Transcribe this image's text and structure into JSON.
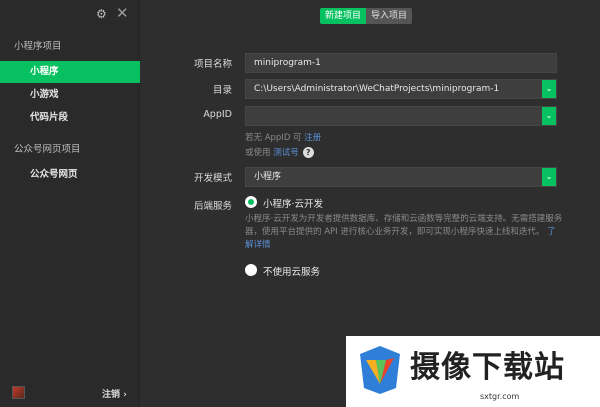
{
  "sidebar": {
    "section_miniprogram": "小程序项目",
    "items_miniprogram": [
      {
        "label": "小程序",
        "active": true
      },
      {
        "label": "小游戏",
        "active": false
      },
      {
        "label": "代码片段",
        "active": false
      }
    ],
    "section_official": "公众号网页项目",
    "items_official": [
      {
        "label": "公众号网页",
        "active": false
      }
    ],
    "logout_label": "注销 ›"
  },
  "tabs": {
    "new_project": "新建项目",
    "import_project": "导入项目"
  },
  "form": {
    "name_label": "项目名称",
    "name_value": "miniprogram-1",
    "dir_label": "目录",
    "dir_value": "C:\\Users\\Administrator\\WeChatProjects\\miniprogram-1",
    "appid_label": "AppID",
    "appid_value": "",
    "hint1_prefix": "若无 AppID 可 ",
    "hint1_link": "注册",
    "hint2_prefix": "或使用 ",
    "hint2_link": "测试号",
    "dev_mode_label": "开发模式",
    "dev_mode_value": "小程序",
    "backend_label": "后端服务",
    "cloud_option": "小程序·云开发",
    "cloud_desc": "小程序·云开发为开发者提供数据库、存储和云函数等完整的云端支持。无需搭建服务器，使用平台提供的 API 进行核心业务开发，即可实现小程序快速上线和迭代。",
    "cloud_link": "了解详情",
    "no_cloud_option": "不使用云服务"
  },
  "watermark": {
    "title": "摄像下载站",
    "url": "sxtgr.com"
  },
  "colors": {
    "accent": "#07c160",
    "link": "#5b8fd6",
    "background": "#2e2e2e",
    "sidebar": "#2a2a2a"
  },
  "icons": {
    "settings": "gear-icon",
    "close": "close-icon",
    "dropdown": "chevron-down-icon",
    "help": "question-icon"
  }
}
